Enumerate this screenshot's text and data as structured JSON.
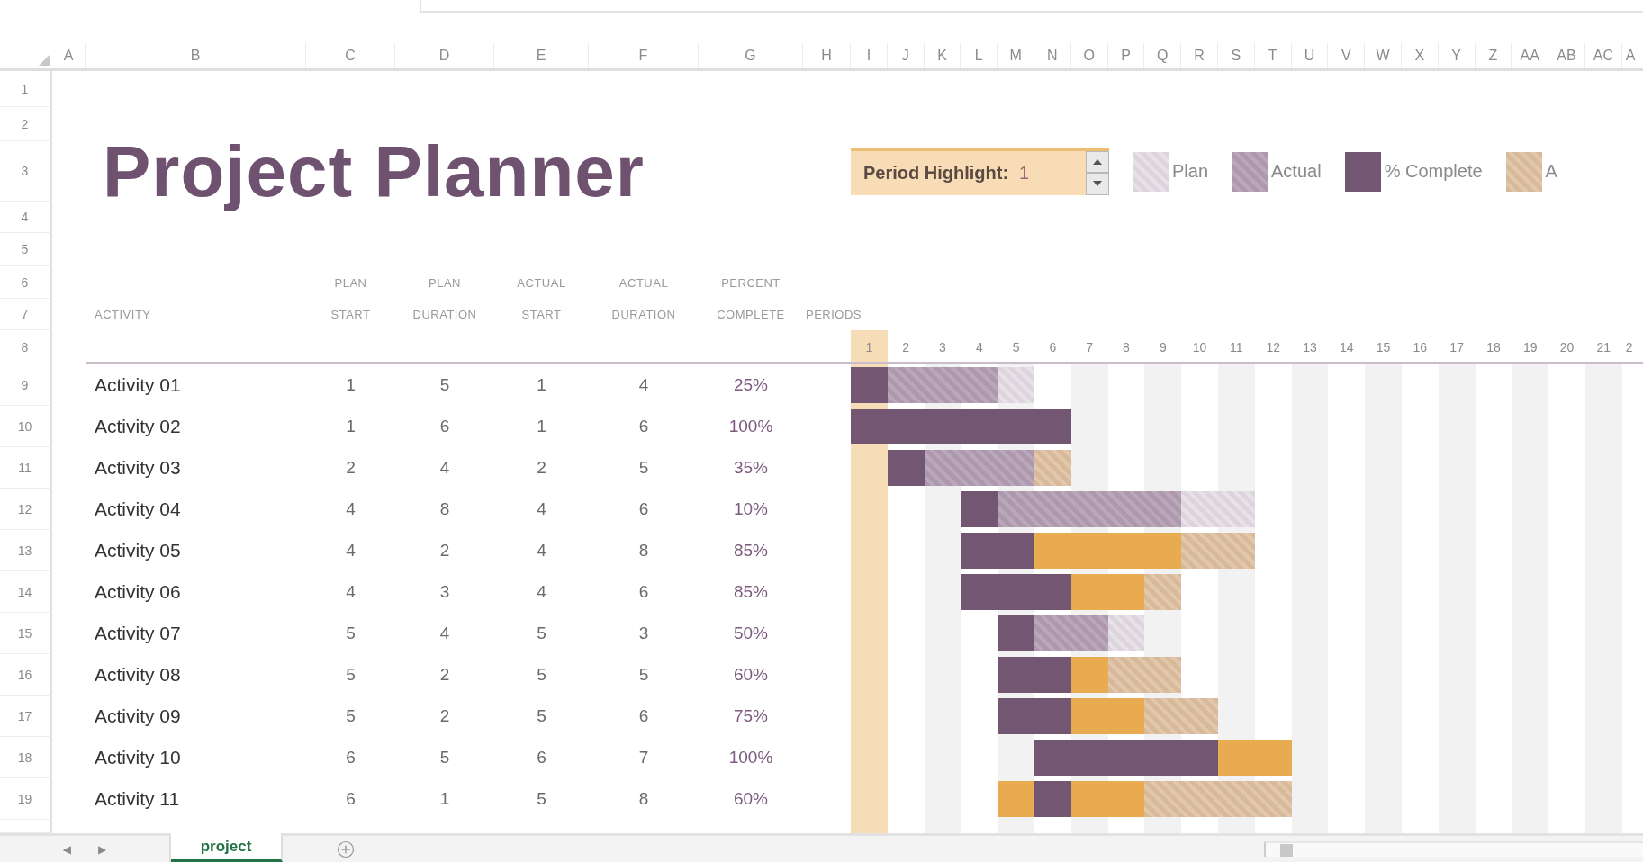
{
  "column_headers": [
    "A",
    "B",
    "C",
    "D",
    "E",
    "F",
    "G",
    "H",
    "I",
    "J",
    "K",
    "L",
    "M",
    "N",
    "O",
    "P",
    "Q",
    "R",
    "S",
    "T",
    "U",
    "V",
    "W",
    "X",
    "Y",
    "Z",
    "AA",
    "AB",
    "AC",
    "A"
  ],
  "row_numbers": [
    "1",
    "2",
    "3",
    "4",
    "5",
    "6",
    "7",
    "8",
    "9",
    "10",
    "11",
    "12",
    "13",
    "14",
    "15",
    "16",
    "17",
    "18",
    "19"
  ],
  "title": "Project Planner",
  "period_highlight": {
    "label": "Period Highlight:",
    "value": "1"
  },
  "legend": [
    {
      "kind": "plan",
      "label": "Plan"
    },
    {
      "kind": "actual",
      "label": "Actual"
    },
    {
      "kind": "complete",
      "label": "% Complete"
    },
    {
      "kind": "actual_beyond",
      "label": "A"
    }
  ],
  "table": {
    "columns": [
      "ACTIVITY",
      "PLAN\nSTART",
      "PLAN\nDURATION",
      "ACTUAL\nSTART",
      "ACTUAL\nDURATION",
      "PERCENT\nCOMPLETE"
    ],
    "periods_label": "PERIODS",
    "periods": [
      "1",
      "2",
      "3",
      "4",
      "5",
      "6",
      "7",
      "8",
      "9",
      "10",
      "11",
      "12",
      "13",
      "14",
      "15",
      "16",
      "17",
      "18",
      "19",
      "20",
      "21",
      "2"
    ],
    "rows": [
      {
        "activity": "Activity 01",
        "plan_start": "1",
        "plan_duration": "5",
        "actual_start": "1",
        "actual_duration": "4",
        "percent_complete": "25%"
      },
      {
        "activity": "Activity 02",
        "plan_start": "1",
        "plan_duration": "6",
        "actual_start": "1",
        "actual_duration": "6",
        "percent_complete": "100%"
      },
      {
        "activity": "Activity 03",
        "plan_start": "2",
        "plan_duration": "4",
        "actual_start": "2",
        "actual_duration": "5",
        "percent_complete": "35%"
      },
      {
        "activity": "Activity 04",
        "plan_start": "4",
        "plan_duration": "8",
        "actual_start": "4",
        "actual_duration": "6",
        "percent_complete": "10%"
      },
      {
        "activity": "Activity 05",
        "plan_start": "4",
        "plan_duration": "2",
        "actual_start": "4",
        "actual_duration": "8",
        "percent_complete": "85%"
      },
      {
        "activity": "Activity 06",
        "plan_start": "4",
        "plan_duration": "3",
        "actual_start": "4",
        "actual_duration": "6",
        "percent_complete": "85%"
      },
      {
        "activity": "Activity 07",
        "plan_start": "5",
        "plan_duration": "4",
        "actual_start": "5",
        "actual_duration": "3",
        "percent_complete": "50%"
      },
      {
        "activity": "Activity 08",
        "plan_start": "5",
        "plan_duration": "2",
        "actual_start": "5",
        "actual_duration": "5",
        "percent_complete": "60%"
      },
      {
        "activity": "Activity 09",
        "plan_start": "5",
        "plan_duration": "2",
        "actual_start": "5",
        "actual_duration": "6",
        "percent_complete": "75%"
      },
      {
        "activity": "Activity 10",
        "plan_start": "6",
        "plan_duration": "5",
        "actual_start": "6",
        "actual_duration": "7",
        "percent_complete": "100%"
      },
      {
        "activity": "Activity 11",
        "plan_start": "6",
        "plan_duration": "1",
        "actual_start": "5",
        "actual_duration": "8",
        "percent_complete": "60%"
      }
    ]
  },
  "sheet_nav": [
    "◀",
    "▶"
  ],
  "sheet_tabs": [
    {
      "label": "project",
      "selected": true
    }
  ]
}
